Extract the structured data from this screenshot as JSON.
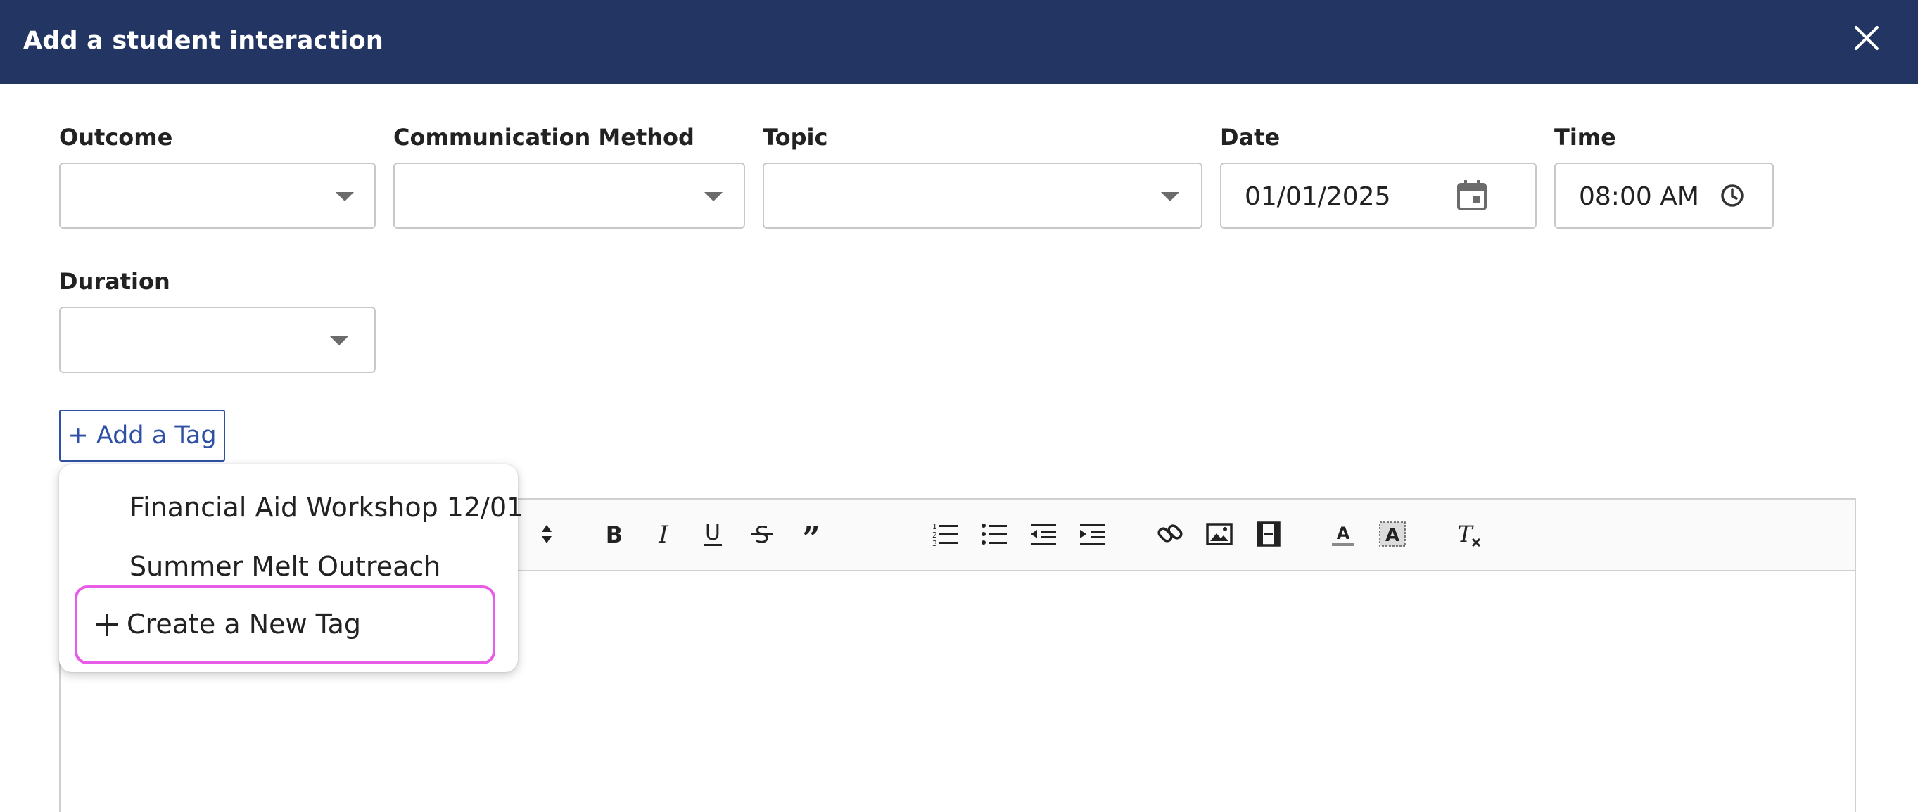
{
  "dialog": {
    "title": "Add a student interaction"
  },
  "fields": {
    "outcome": {
      "label": "Outcome",
      "value": ""
    },
    "communication_method": {
      "label": "Communication Method",
      "value": ""
    },
    "topic": {
      "label": "Topic",
      "value": ""
    },
    "date": {
      "label": "Date",
      "value": "01/01/2025"
    },
    "time": {
      "label": "Time",
      "value": "08:00 AM"
    },
    "duration": {
      "label": "Duration",
      "value": ""
    }
  },
  "tags": {
    "add_label": "+ Add a Tag",
    "options": [
      {
        "label": "Financial Aid Workshop 12/01"
      },
      {
        "label": "Summer Melt Outreach"
      }
    ],
    "create_label": "Create a New Tag"
  },
  "colors": {
    "header_bg": "#233562",
    "link_blue": "#2f51a5",
    "highlight": "#e85ce8"
  },
  "toolbar": {
    "icons": [
      "size-stepper-icon",
      "bold-icon",
      "italic-icon",
      "underline-icon",
      "strikethrough-icon",
      "quote-icon",
      "ordered-list-icon",
      "bullet-list-icon",
      "outdent-icon",
      "indent-icon",
      "link-icon",
      "image-icon",
      "video-icon",
      "font-color-icon",
      "background-color-icon",
      "clear-formatting-icon"
    ]
  }
}
